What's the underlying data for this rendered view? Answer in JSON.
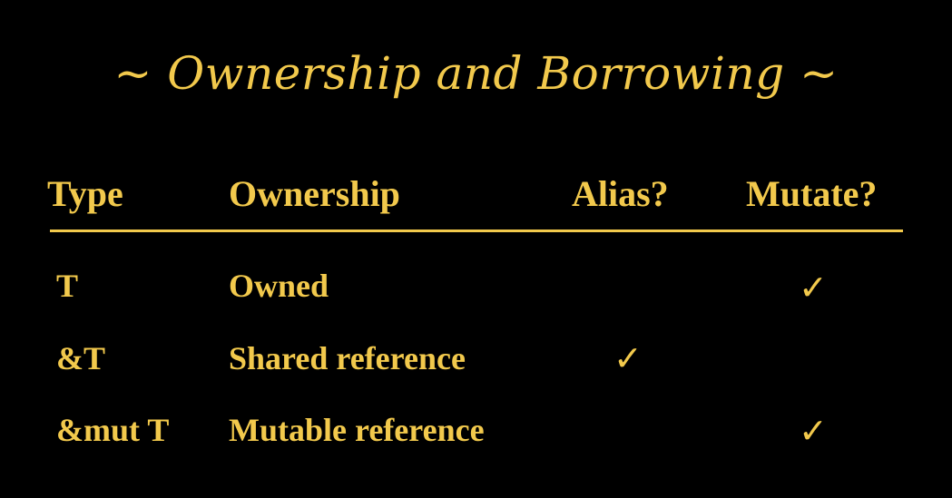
{
  "slide": {
    "title": "~ Ownership and Borrowing ~",
    "accent_color": "#f2c94c",
    "background_color": "#000000"
  },
  "table": {
    "headers": {
      "type": "Type",
      "ownership": "Ownership",
      "alias": "Alias?",
      "mutate": "Mutate?"
    },
    "check_glyph": "✓",
    "rows": [
      {
        "type": "T",
        "ownership": "Owned",
        "alias": false,
        "mutate": true
      },
      {
        "type": "&T",
        "ownership": "Shared reference",
        "alias": true,
        "mutate": false
      },
      {
        "type": "&mut T",
        "ownership": "Mutable reference",
        "alias": false,
        "mutate": true
      }
    ]
  }
}
